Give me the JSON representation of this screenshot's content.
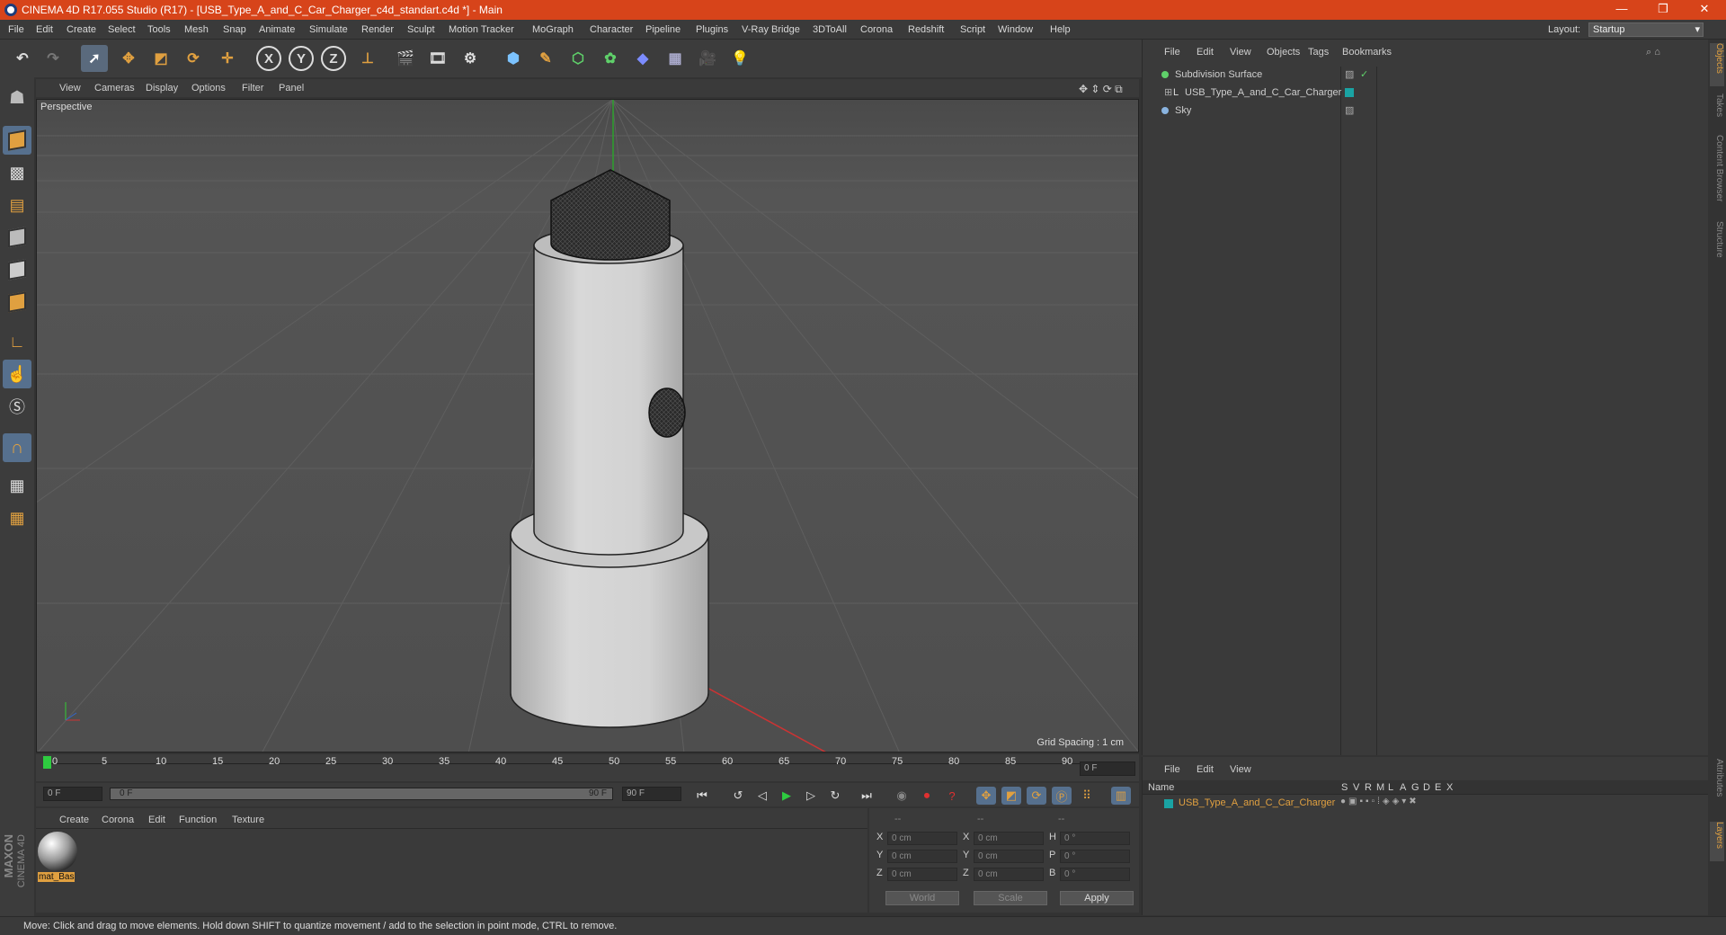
{
  "window": {
    "title": "CINEMA 4D R17.055 Studio (R17) - [USB_Type_A_and_C_Car_Charger_c4d_standart.c4d *] - Main"
  },
  "menu": [
    "File",
    "Edit",
    "Create",
    "Select",
    "Tools",
    "Mesh",
    "Snap",
    "Animate",
    "Simulate",
    "Render",
    "Sculpt",
    "Motion Tracker",
    "MoGraph",
    "Character",
    "Pipeline",
    "Plugins",
    "V-Ray Bridge",
    "3DToAll",
    "Corona",
    "Redshift",
    "Script",
    "Window",
    "Help"
  ],
  "layout": {
    "label": "Layout:",
    "value": "Startup"
  },
  "toolbar": {
    "axes": [
      "X",
      "Y",
      "Z"
    ]
  },
  "viewport": {
    "menu": [
      "View",
      "Cameras",
      "Display",
      "Options",
      "Filter",
      "Panel"
    ],
    "label": "Perspective",
    "grid_spacing": "Grid Spacing : 1 cm"
  },
  "timeline": {
    "ticks": [
      "0",
      "5",
      "10",
      "15",
      "20",
      "25",
      "30",
      "35",
      "40",
      "45",
      "50",
      "55",
      "60",
      "65",
      "70",
      "75",
      "80",
      "85",
      "90"
    ],
    "current_frame": "0 F",
    "start": "0 F",
    "range_start": "0 F",
    "range_end": "90 F",
    "end": "90 F"
  },
  "material_manager": {
    "menu": [
      "Create",
      "Corona",
      "Edit",
      "Function",
      "Texture"
    ],
    "materials": [
      {
        "name": "mat_Bas"
      }
    ]
  },
  "coordinates": {
    "headers": [
      "--",
      "--",
      "--"
    ],
    "rows": [
      {
        "a": "X",
        "av": "0 cm",
        "b": "X",
        "bv": "0 cm",
        "c": "H",
        "cv": "0 °"
      },
      {
        "a": "Y",
        "av": "0 cm",
        "b": "Y",
        "bv": "0 cm",
        "c": "P",
        "cv": "0 °"
      },
      {
        "a": "Z",
        "av": "0 cm",
        "b": "Z",
        "bv": "0 cm",
        "c": "B",
        "cv": "0 °"
      }
    ],
    "mode": "World",
    "size_mode": "Scale",
    "apply": "Apply"
  },
  "status": "Move: Click and drag to move elements. Hold down SHIFT to quantize movement / add to the selection in point mode, CTRL to remove.",
  "object_manager": {
    "menu": [
      "File",
      "Edit",
      "View",
      "Objects",
      "Tags",
      "Bookmarks"
    ],
    "objects": [
      {
        "name": "Subdivision Surface"
      },
      {
        "name": "USB_Type_A_and_C_Car_Charger"
      },
      {
        "name": "Sky"
      }
    ]
  },
  "layer_manager": {
    "menu": [
      "File",
      "Edit",
      "View"
    ],
    "columns": [
      "Name",
      "S",
      "V",
      "R",
      "M",
      "L",
      "A",
      "G",
      "D",
      "E",
      "X"
    ],
    "layers": [
      {
        "name": "USB_Type_A_and_C_Car_Charger",
        "color": "#1aa3a3"
      }
    ]
  },
  "right_tabs": [
    "Objects",
    "Takes",
    "Content Browser",
    "Structure",
    "Attributes",
    "Layers"
  ],
  "logo": {
    "line1": "MAXON",
    "line2": "CINEMA 4D"
  },
  "colors": {
    "accent": "#d7441a",
    "selection": "#e0a040",
    "layer": "#1aa3a3"
  }
}
